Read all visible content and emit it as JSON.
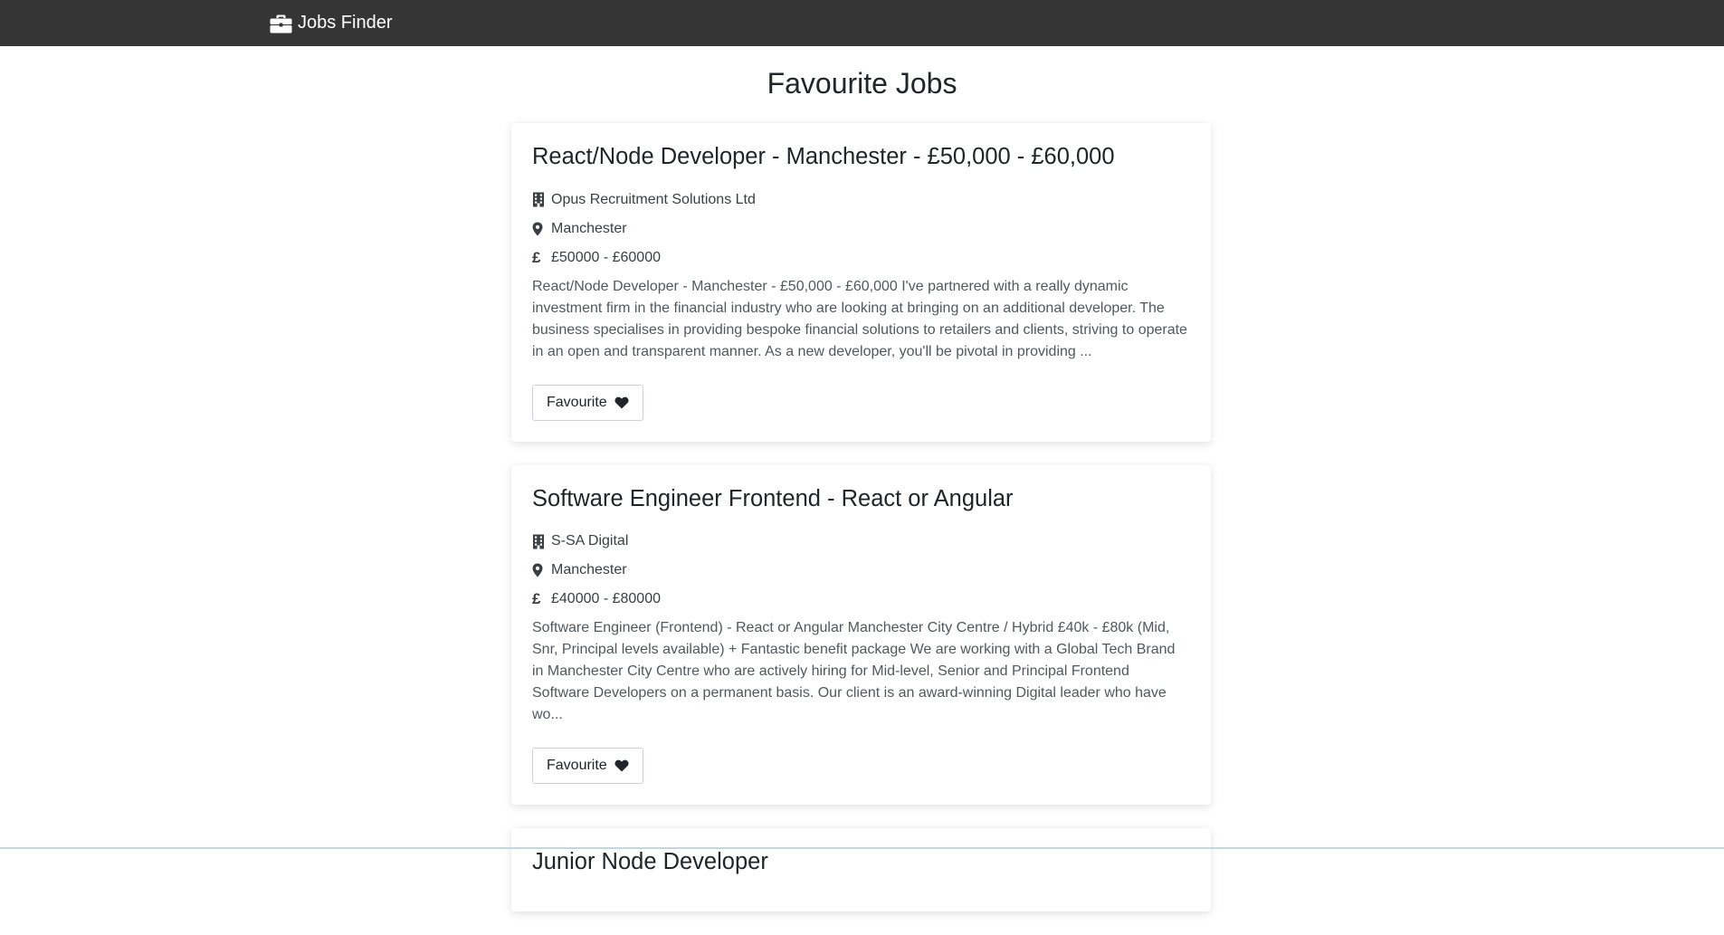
{
  "navbar": {
    "brand_label": "Jobs Finder",
    "brand_icon": "briefcase-icon",
    "background": "#353535"
  },
  "page": {
    "title": "Favourite Jobs"
  },
  "jobs": [
    {
      "title": "React/Node Developer - Manchester - £50,000 - £60,000",
      "company": "Opus Recruitment Solutions Ltd",
      "location": "Manchester",
      "salary": "£50000 - £60000",
      "description": "React/Node Developer - Manchester - £50,000 - £60,000 I've partnered with a really dynamic investment firm in the financial industry who are looking at bringing on an additional developer. The business specialises in providing bespoke financial solutions to retailers and clients, striving to operate in an open and transparent manner. As a new developer, you'll be pivotal in providing ...",
      "button_label": "Favourite"
    },
    {
      "title": "Software Engineer Frontend - React or Angular",
      "company": "S-SA Digital",
      "location": "Manchester",
      "salary": "£40000 - £80000",
      "description": "Software Engineer (Frontend) - React or Angular Manchester City Centre / Hybrid £40k - £80k (Mid, Snr, Principal levels available) + Fantastic benefit package We are working with a Global Tech Brand in Manchester City Centre who are actively hiring for Mid-level, Senior and Principal Frontend Software Developers on a permanent basis. Our client is an award-winning Digital leader who have wo...",
      "button_label": "Favourite"
    },
    {
      "title": "Junior Node Developer"
    }
  ],
  "icons": {
    "company": "building-icon",
    "location": "map-marker-icon",
    "salary": "pound-sign-icon",
    "favourite": "heart-icon"
  }
}
